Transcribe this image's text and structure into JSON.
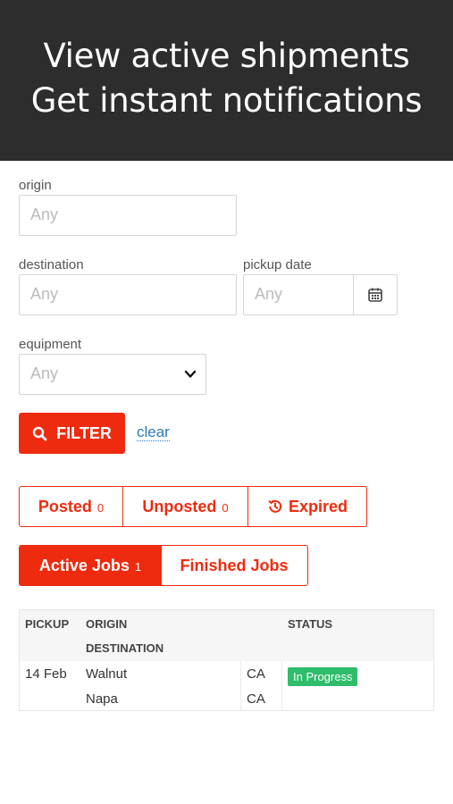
{
  "banner": {
    "line1": "View active shipments",
    "line2": "Get instant notifications"
  },
  "filters": {
    "origin_label": "origin",
    "origin_placeholder": "Any",
    "destination_label": "destination",
    "destination_placeholder": "Any",
    "pickup_date_label": "pickup date",
    "pickup_date_placeholder": "Any",
    "equipment_label": "equipment",
    "equipment_value": "Any",
    "filter_button": "FILTER",
    "clear_link": "clear"
  },
  "post_tabs": [
    {
      "label": "Posted",
      "count": "0"
    },
    {
      "label": "Unposted",
      "count": "0"
    },
    {
      "label": "Expired",
      "count": ""
    }
  ],
  "job_tabs": [
    {
      "label": "Active Jobs",
      "count": "1",
      "active": true
    },
    {
      "label": "Finished Jobs",
      "count": "",
      "active": false
    }
  ],
  "table": {
    "headers": {
      "pickup": "PICKUP",
      "origin": "ORIGIN",
      "destination": "DESTINATION",
      "status": "STATUS"
    },
    "rows": [
      {
        "pickup": "14 Feb",
        "origin_city": "Walnut",
        "origin_state": "CA",
        "dest_city": "Napa",
        "dest_state": "CA",
        "status": "In Progress"
      }
    ]
  },
  "colors": {
    "accent": "#ee2b0f",
    "banner_bg": "#2d2d2d",
    "status_green": "#2ebd6b",
    "link": "#2a7ab8"
  }
}
